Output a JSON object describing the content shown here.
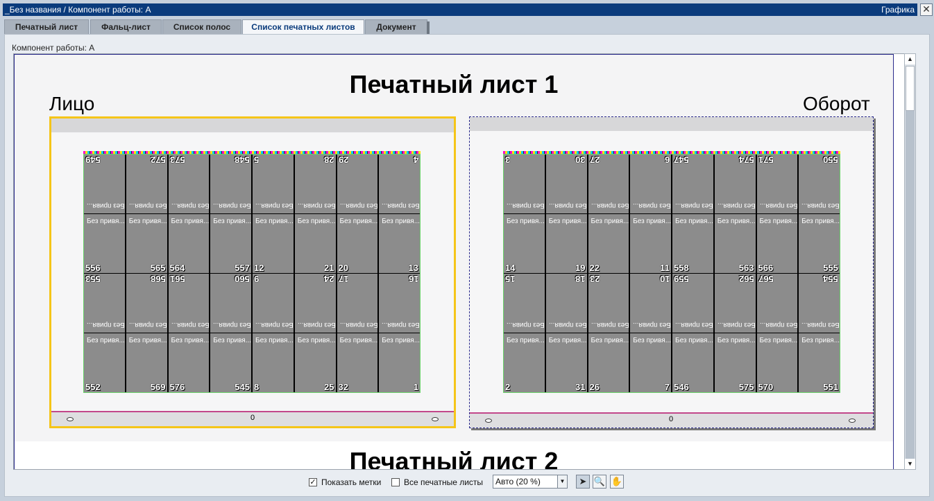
{
  "window": {
    "title": "_Без названия / Компонент работы: A",
    "right_label": "Графика",
    "close_symbol": "✕"
  },
  "tabs": [
    {
      "label": "Печатный лист",
      "active": false
    },
    {
      "label": "Фальц-лист",
      "active": false
    },
    {
      "label": "Список полос",
      "active": false
    },
    {
      "label": "Список печатных листов",
      "active": true
    },
    {
      "label": "Документ",
      "active": false
    }
  ],
  "panel": {
    "label": "Компонент работы: A"
  },
  "sheets": [
    {
      "title": "Печатный лист 1",
      "front_label": "Лицо",
      "back_label": "Оборот",
      "front_selected_color": "#f5c518",
      "back_border_color": "#2a2a8c",
      "page_caption": "Без привя...",
      "front_rows": [
        {
          "flip": true,
          "pages": [
            [
              "549",
              ""
            ],
            [
              "",
              "572"
            ],
            [
              "573",
              ""
            ],
            [
              "",
              "548"
            ],
            [
              "5",
              ""
            ],
            [
              "",
              "28"
            ],
            [
              "29",
              ""
            ],
            [
              "",
              "4"
            ]
          ]
        },
        {
          "flip": false,
          "pages": [
            [
              "556",
              ""
            ],
            [
              "",
              "565"
            ],
            [
              "564",
              ""
            ],
            [
              "",
              "557"
            ],
            [
              "12",
              ""
            ],
            [
              "",
              "21"
            ],
            [
              "20",
              ""
            ],
            [
              "",
              "13"
            ]
          ]
        },
        {
          "flip": true,
          "pages": [
            [
              "553",
              ""
            ],
            [
              "",
              "568"
            ],
            [
              "561",
              ""
            ],
            [
              "",
              "560"
            ],
            [
              "9",
              ""
            ],
            [
              "",
              "24"
            ],
            [
              "17",
              ""
            ],
            [
              "",
              "16"
            ]
          ]
        },
        {
          "flip": false,
          "pages": [
            [
              "552",
              ""
            ],
            [
              "",
              "569"
            ],
            [
              "576",
              ""
            ],
            [
              "",
              "545"
            ],
            [
              "8",
              ""
            ],
            [
              "",
              "25"
            ],
            [
              "32",
              ""
            ],
            [
              "",
              "1"
            ]
          ]
        }
      ],
      "back_rows": [
        {
          "flip": true,
          "pages": [
            [
              "3",
              ""
            ],
            [
              "",
              "30"
            ],
            [
              "27",
              ""
            ],
            [
              "",
              "6"
            ],
            [
              "547",
              ""
            ],
            [
              "",
              "574"
            ],
            [
              "571",
              ""
            ],
            [
              "",
              "550"
            ]
          ]
        },
        {
          "flip": false,
          "pages": [
            [
              "14",
              ""
            ],
            [
              "",
              "19"
            ],
            [
              "22",
              ""
            ],
            [
              "",
              "11"
            ],
            [
              "558",
              ""
            ],
            [
              "",
              "563"
            ],
            [
              "566",
              ""
            ],
            [
              "",
              "555"
            ]
          ]
        },
        {
          "flip": true,
          "pages": [
            [
              "15",
              ""
            ],
            [
              "",
              "18"
            ],
            [
              "23",
              ""
            ],
            [
              "",
              "10"
            ],
            [
              "559",
              ""
            ],
            [
              "",
              "562"
            ],
            [
              "567",
              ""
            ],
            [
              "",
              "554"
            ]
          ]
        },
        {
          "flip": false,
          "pages": [
            [
              "2",
              ""
            ],
            [
              "",
              "31"
            ],
            [
              "26",
              ""
            ],
            [
              "",
              "7"
            ],
            [
              "546",
              ""
            ],
            [
              "",
              "575"
            ],
            [
              "570",
              ""
            ],
            [
              "",
              "551"
            ]
          ]
        }
      ],
      "center_mark": "0"
    },
    {
      "title": "Печатный лист 2"
    }
  ],
  "footer": {
    "show_marks_label": "Показать метки",
    "show_marks_checked": true,
    "all_sheets_label": "Все печатные листы",
    "all_sheets_checked": false,
    "zoom_value": "Авто (20 %)",
    "check_symbol": "✓",
    "dropdown_symbol": "▼",
    "tools": [
      {
        "icon": "pointer-icon",
        "glyph": "➤",
        "active": true
      },
      {
        "icon": "zoom-icon",
        "glyph": "🔍",
        "active": false
      },
      {
        "icon": "hand-icon",
        "glyph": "✋",
        "active": false
      }
    ]
  },
  "scroll": {
    "up_symbol": "▲",
    "down_symbol": "▼"
  }
}
